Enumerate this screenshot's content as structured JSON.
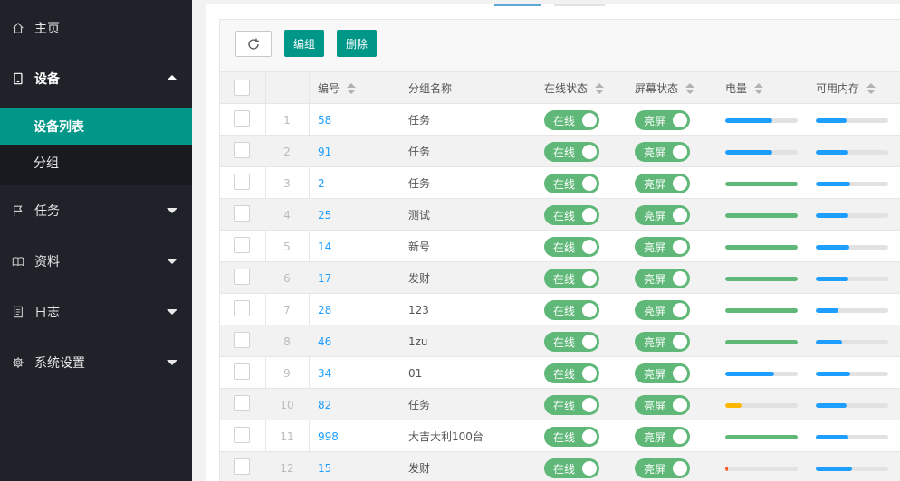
{
  "sidebar": {
    "items": [
      {
        "label": "主页",
        "icon": "home-icon"
      },
      {
        "label": "设备",
        "icon": "tablet-icon"
      },
      {
        "label": "任务",
        "icon": "flag-icon"
      },
      {
        "label": "资料",
        "icon": "book-icon"
      },
      {
        "label": "日志",
        "icon": "log-icon"
      },
      {
        "label": "系统设置",
        "icon": "gear-icon"
      }
    ],
    "submenu": [
      {
        "label": "设备列表",
        "active": true
      },
      {
        "label": "分组",
        "active": false
      }
    ]
  },
  "toolbar": {
    "refresh_icon": "refresh-icon",
    "edit_label": "编组",
    "delete_label": "删除"
  },
  "table": {
    "headers": {
      "number": "编号",
      "group": "分组名称",
      "online": "在线状态",
      "screen": "屏幕状态",
      "battery": "电量",
      "memory": "可用内存"
    },
    "rows": [
      {
        "idx": "1",
        "number": "58",
        "group": "任务",
        "online": "在线",
        "screen": "亮屏",
        "battery": 0.65,
        "battery_color": "#1e9fff",
        "memory": 0.43
      },
      {
        "idx": "2",
        "number": "91",
        "group": "任务",
        "online": "在线",
        "screen": "亮屏",
        "battery": 0.65,
        "battery_color": "#1e9fff",
        "memory": 0.45
      },
      {
        "idx": "3",
        "number": "2",
        "group": "任务",
        "online": "在线",
        "screen": "亮屏",
        "battery": 1.0,
        "battery_color": "#5fb878",
        "memory": 0.47
      },
      {
        "idx": "4",
        "number": "25",
        "group": "测试",
        "online": "在线",
        "screen": "亮屏",
        "battery": 1.0,
        "battery_color": "#5fb878",
        "memory": 0.45
      },
      {
        "idx": "5",
        "number": "14",
        "group": "新号",
        "online": "在线",
        "screen": "亮屏",
        "battery": 1.0,
        "battery_color": "#5fb878",
        "memory": 0.46
      },
      {
        "idx": "6",
        "number": "17",
        "group": "发财",
        "online": "在线",
        "screen": "亮屏",
        "battery": 1.0,
        "battery_color": "#5fb878",
        "memory": 0.45
      },
      {
        "idx": "7",
        "number": "28",
        "group": "123",
        "online": "在线",
        "screen": "亮屏",
        "battery": 1.0,
        "battery_color": "#5fb878",
        "memory": 0.31
      },
      {
        "idx": "8",
        "number": "46",
        "group": "1zu",
        "online": "在线",
        "screen": "亮屏",
        "battery": 1.0,
        "battery_color": "#5fb878",
        "memory": 0.36
      },
      {
        "idx": "9",
        "number": "34",
        "group": "01",
        "online": "在线",
        "screen": "亮屏",
        "battery": 0.68,
        "battery_color": "#1e9fff",
        "memory": 0.47
      },
      {
        "idx": "10",
        "number": "82",
        "group": "任务",
        "online": "在线",
        "screen": "亮屏",
        "battery": 0.23,
        "battery_color": "#ffb800",
        "memory": 0.42
      },
      {
        "idx": "11",
        "number": "998",
        "group": "大吉大利100台",
        "online": "在线",
        "screen": "亮屏",
        "battery": 1.0,
        "battery_color": "#5fb878",
        "memory": 0.45
      },
      {
        "idx": "12",
        "number": "15",
        "group": "发财",
        "online": "在线",
        "screen": "亮屏",
        "battery": 0.04,
        "battery_color": "#ff5722",
        "memory": 0.5
      }
    ]
  }
}
